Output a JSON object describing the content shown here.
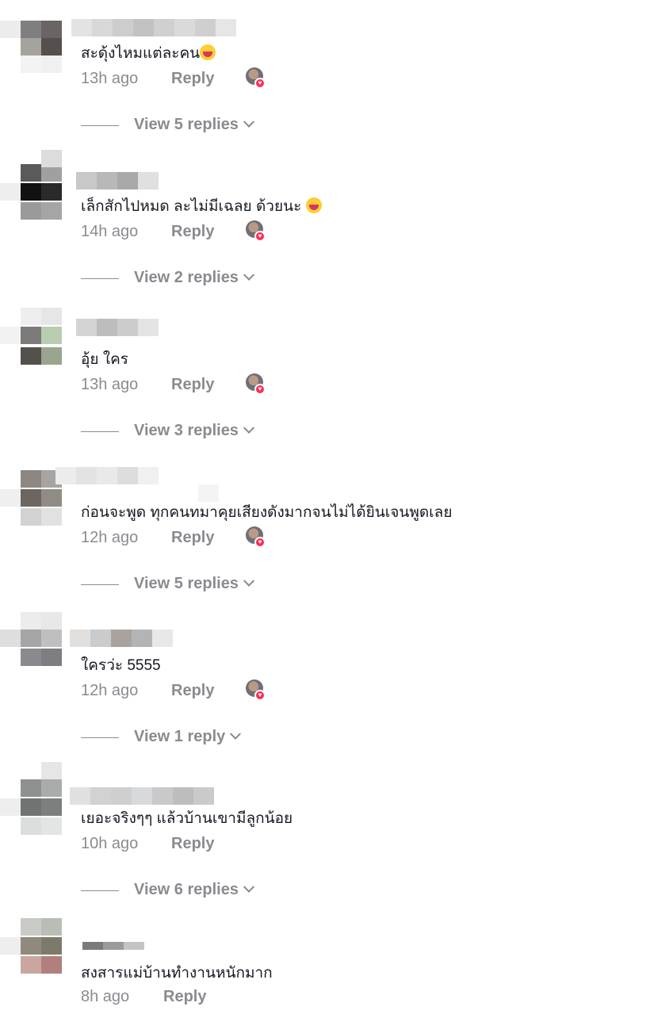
{
  "comments": [
    {
      "text": "สะดุ้งไหมแต่ละคน",
      "emoji": "laughing-emoji",
      "time": "13h ago",
      "reply": "Reply",
      "view_replies": "View 5 replies"
    },
    {
      "text": "เล็กสักไปหมด ละไม่มีเฉลย ด้วยนะ ",
      "emoji": "laughing-emoji",
      "time": "14h ago",
      "reply": "Reply",
      "view_replies": "View 2 replies"
    },
    {
      "text": "อุ้ย ใคร",
      "time": "13h ago",
      "reply": "Reply",
      "view_replies": "View 3 replies"
    },
    {
      "text": "ก่อนจะพูด ทุกคนทมาคุยเสียงดังมากจนไม่ได้ยินเจนพูดเลย",
      "time": "12h ago",
      "reply": "Reply",
      "view_replies": "View 5 replies"
    },
    {
      "text": "ใครว่ะ 5555",
      "time": "12h ago",
      "reply": "Reply",
      "view_replies": "View 1 reply"
    },
    {
      "text": "เยอะจริงๆๆ แล้วบ้านเขามีลูกน้อย",
      "time": "10h ago",
      "reply": "Reply",
      "view_replies": "View 6 replies"
    },
    {
      "text": "สงสารแม่บ้านทำงานหนักมาก",
      "time": "8h ago",
      "reply": "Reply"
    }
  ],
  "colors": {
    "meta_text": "#8a8b91",
    "comment_text": "#161823",
    "creator_badge": "#fe2c55"
  }
}
